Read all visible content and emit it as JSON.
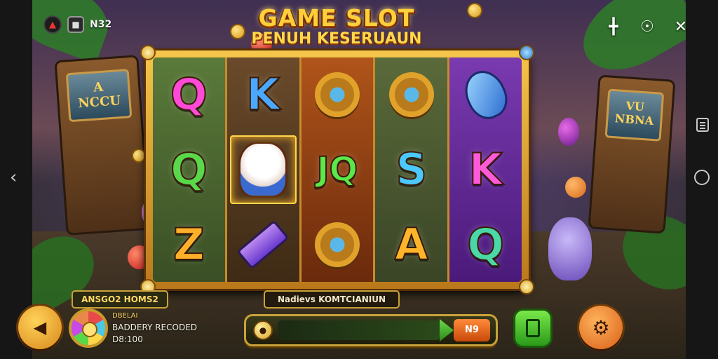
{
  "status_bar": {
    "signal_text": "N32"
  },
  "title": {
    "line1": "GAME SLOT",
    "line2": "PENUH KESERUAUN"
  },
  "reels": [
    [
      "Q",
      "Q",
      "Z"
    ],
    [
      "K",
      "mascot",
      "hammer"
    ],
    [
      "ring",
      "JQ",
      "ring"
    ],
    [
      "ring",
      "S",
      "A"
    ],
    [
      "gem",
      "K",
      "Q"
    ]
  ],
  "arcade_left": {
    "screen_text": "A\nNCCU"
  },
  "arcade_right": {
    "screen_text": "VU\nNBNA"
  },
  "bottom": {
    "panel_label": "ANSGO2 HOMS2",
    "info_title": "DBELAI",
    "info_line1": "BADDERY RECODED",
    "info_line2": "D8:100",
    "message": "Nadievs KOMTCIANIUN",
    "bet_value": "N9"
  },
  "colors": {
    "gold": "#ffcf3a",
    "reel_frame": "#d9a22a",
    "accent_green": "#4ac81a",
    "accent_orange": "#e87a1a"
  }
}
